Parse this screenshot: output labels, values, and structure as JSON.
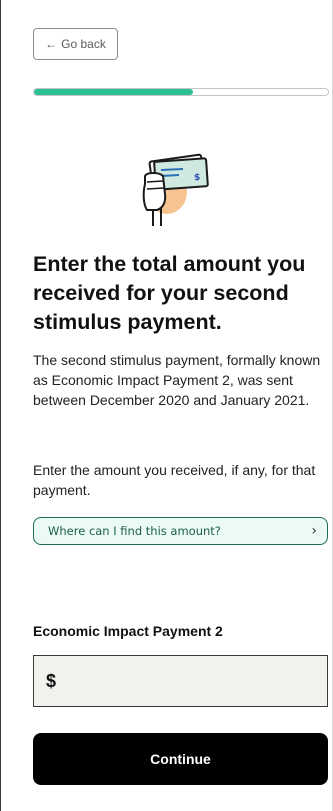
{
  "nav": {
    "back_icon": "←",
    "back_label": "Go back"
  },
  "progress": {
    "fraction": 0.54
  },
  "illustration": {
    "icon": "hand-holding-check-icon"
  },
  "main": {
    "heading": "Enter the total amount you received for your second stimulus payment.",
    "description": "The second stimulus payment, formally known as Economic Impact Payment 2, was sent between December 2020 and January 2021.",
    "instruction": "Enter the amount you received, if any, for that payment.",
    "help_link": {
      "label": "Where can I find this amount?",
      "chevron": "›"
    }
  },
  "form": {
    "field_label": "Economic Impact Payment 2",
    "currency_symbol": "$",
    "value": ""
  },
  "actions": {
    "continue_label": "Continue"
  },
  "colors": {
    "accent": "#2bbf93",
    "help_border": "#1a6f57",
    "help_bg": "#ecfaf4",
    "button": "#000000"
  }
}
